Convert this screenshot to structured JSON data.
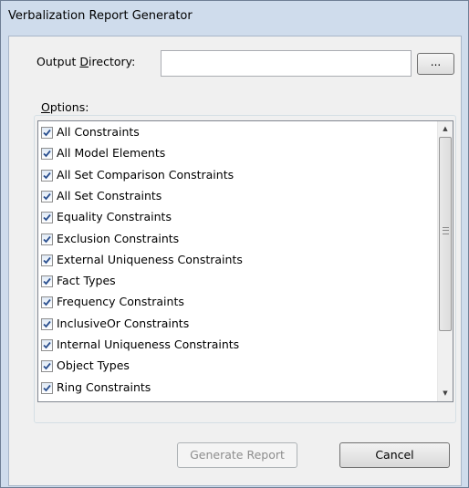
{
  "window": {
    "title": "Verbalization Report Generator"
  },
  "output": {
    "label_prefix": "Output ",
    "label_accel": "D",
    "label_suffix": "irectory:",
    "value": "",
    "browse_label": "..."
  },
  "options": {
    "label_accel": "O",
    "label_suffix": "ptions:",
    "items": [
      {
        "label": "All Constraints",
        "checked": true
      },
      {
        "label": "All Model Elements",
        "checked": true
      },
      {
        "label": "All Set Comparison Constraints",
        "checked": true
      },
      {
        "label": "All Set Constraints",
        "checked": true
      },
      {
        "label": "Equality Constraints",
        "checked": true
      },
      {
        "label": "Exclusion Constraints",
        "checked": true
      },
      {
        "label": "External Uniqueness Constraints",
        "checked": true
      },
      {
        "label": "Fact Types",
        "checked": true
      },
      {
        "label": "Frequency Constraints",
        "checked": true
      },
      {
        "label": "InclusiveOr Constraints",
        "checked": true
      },
      {
        "label": "Internal Uniqueness Constraints",
        "checked": true
      },
      {
        "label": "Object Types",
        "checked": true
      },
      {
        "label": "Ring Constraints",
        "checked": true
      }
    ]
  },
  "buttons": {
    "generate_label": "Generate Report",
    "generate_enabled": false,
    "cancel_label": "Cancel"
  },
  "colors": {
    "window_frame": "#cfdcec",
    "dialog_bg": "#f0f0f0",
    "checkmark": "#2a4f8f",
    "disabled_text": "#8d8d8d"
  }
}
